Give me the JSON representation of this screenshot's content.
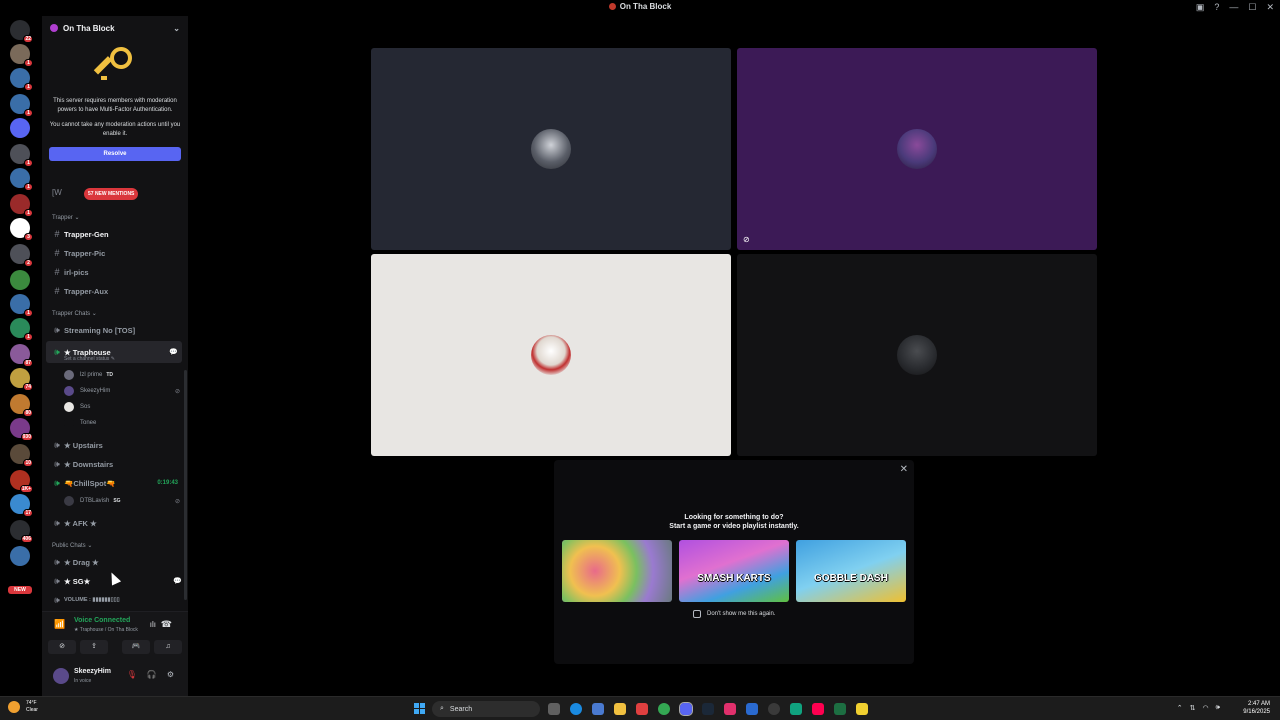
{
  "window": {
    "title": "On Tha Block",
    "controls": [
      "—",
      "☐",
      "✕"
    ]
  },
  "server": {
    "name": "On Tha Block"
  },
  "mfa_notice": {
    "line1": "This server requires members with moderation powers to have Multi-Factor Authentication.",
    "line2": "You cannot take any moderation actions until you enable it.",
    "resolve_label": "Resolve"
  },
  "mentions_pill": "57 NEW MENTIONS",
  "partial_channel": "[W",
  "categories": {
    "trapper": "Trapper ⌄",
    "trapper_chats": "Trapper Chats ⌄",
    "public_chats": "Public Chats ⌄"
  },
  "channels": {
    "trapper_gen": "Trapper-Gen",
    "trapper_pic": "Trapper-Pic",
    "irl_pics": "irl-pics",
    "trapper_aux": "Trapper-Aux",
    "streaming": "Streaming No  [TOS]",
    "traphouse": "★ Traphouse",
    "traphouse_status": "Set a channel status ✎",
    "upstairs": "★ Upstairs",
    "downstairs": "★ Downstairs",
    "chillspot": "🔫ChillSpot🔫",
    "chillspot_timer": "0:19:43",
    "afk": "★ AFK ★",
    "drag": "★ Drag ★",
    "sg": "★ SG★",
    "volume": "VOLUME : ▮▮▮▮▮▮▯▯▯"
  },
  "voice_users": {
    "u1": "lzl prime",
    "u1_tag": "TD",
    "u2": "SkeezyHim",
    "u3": "Sos",
    "u4": "Tonee",
    "u5": "DTBLavish",
    "u5_tag": "SG"
  },
  "server_badges": [
    "22",
    "1",
    "1",
    "1",
    "1",
    "1",
    "1",
    "3",
    "2",
    "1",
    "1",
    "87",
    "74",
    "80",
    "930",
    "10",
    "1K+",
    "17",
    "406"
  ],
  "server_new_badge": "NEW",
  "voice_panel": {
    "title": "Voice Connected",
    "subtitle": "★ Traphouse / On Tha Block",
    "user_name": "SkeezyHim",
    "user_status": "In voice"
  },
  "activity": {
    "title_line1": "Looking for something to do?",
    "title_line2": "Start a game or video playlist instantly.",
    "games": [
      "",
      "SMASH KARTS",
      "GOBBLE DASH"
    ],
    "dont_show": "Don't show me this again."
  },
  "taskbar": {
    "weather_temp": "74°F",
    "weather_desc": "Clear",
    "search_label": "Search",
    "time": "2:47 AM",
    "date": "9/16/2025"
  },
  "colors": {
    "tile1": "#252833",
    "tile2": "#3c1a56",
    "tile3": "#e8e6e3",
    "tile4": "#121214",
    "accent": "#5865f2",
    "voice_green": "#23a55a",
    "danger": "#da373c"
  }
}
